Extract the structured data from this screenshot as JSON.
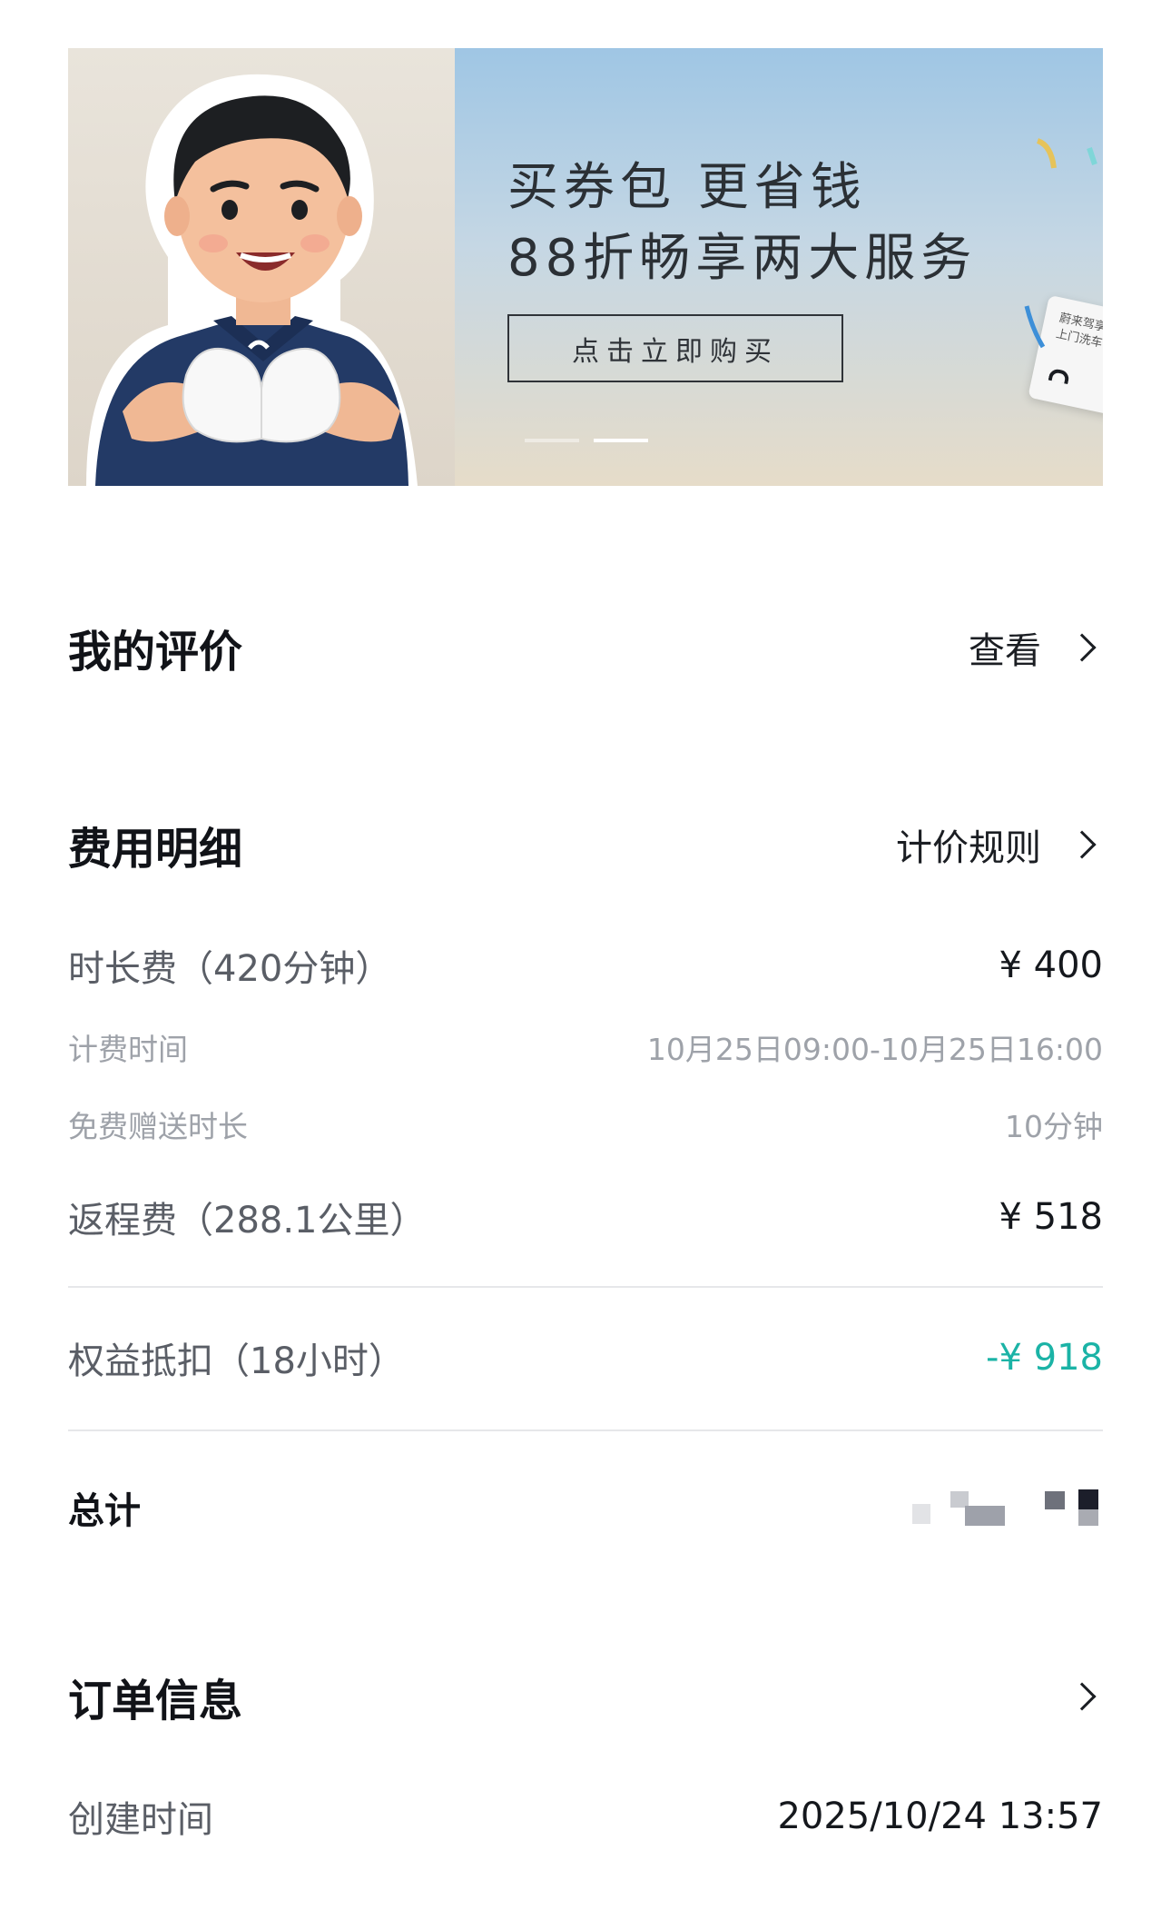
{
  "banner": {
    "title_line1": "买券包 更省钱",
    "title_line2": "88折畅享两大服务",
    "button_label": "点击立即购买",
    "card_line1": "蔚来驾享",
    "card_line2": "上门洗车",
    "pagination_total": 2,
    "pagination_active": 2
  },
  "reviews": {
    "title": "我的评价",
    "link_label": "查看"
  },
  "fees": {
    "title": "费用明细",
    "link_label": "计价规则",
    "duration_label": "时长费（420分钟）",
    "duration_value": "¥ 400",
    "billing_time_label": "计费时间",
    "billing_time_value": "10月25日09:00-10月25日16:00",
    "free_time_label": "免费赠送时长",
    "free_time_value": "10分钟",
    "return_label": "返程费（288.1公里）",
    "return_value": "¥ 518",
    "benefit_label": "权益抵扣（18小时）",
    "benefit_value": "-¥ 918",
    "total_label": "总计"
  },
  "order": {
    "title": "订单信息",
    "created_label": "创建时间",
    "created_value": "2025/10/24 13:57"
  },
  "colors": {
    "accent_green": "#1bb3a6",
    "text_primary": "#111318",
    "text_secondary": "#5a5e66",
    "text_muted": "#9ea2a9"
  }
}
